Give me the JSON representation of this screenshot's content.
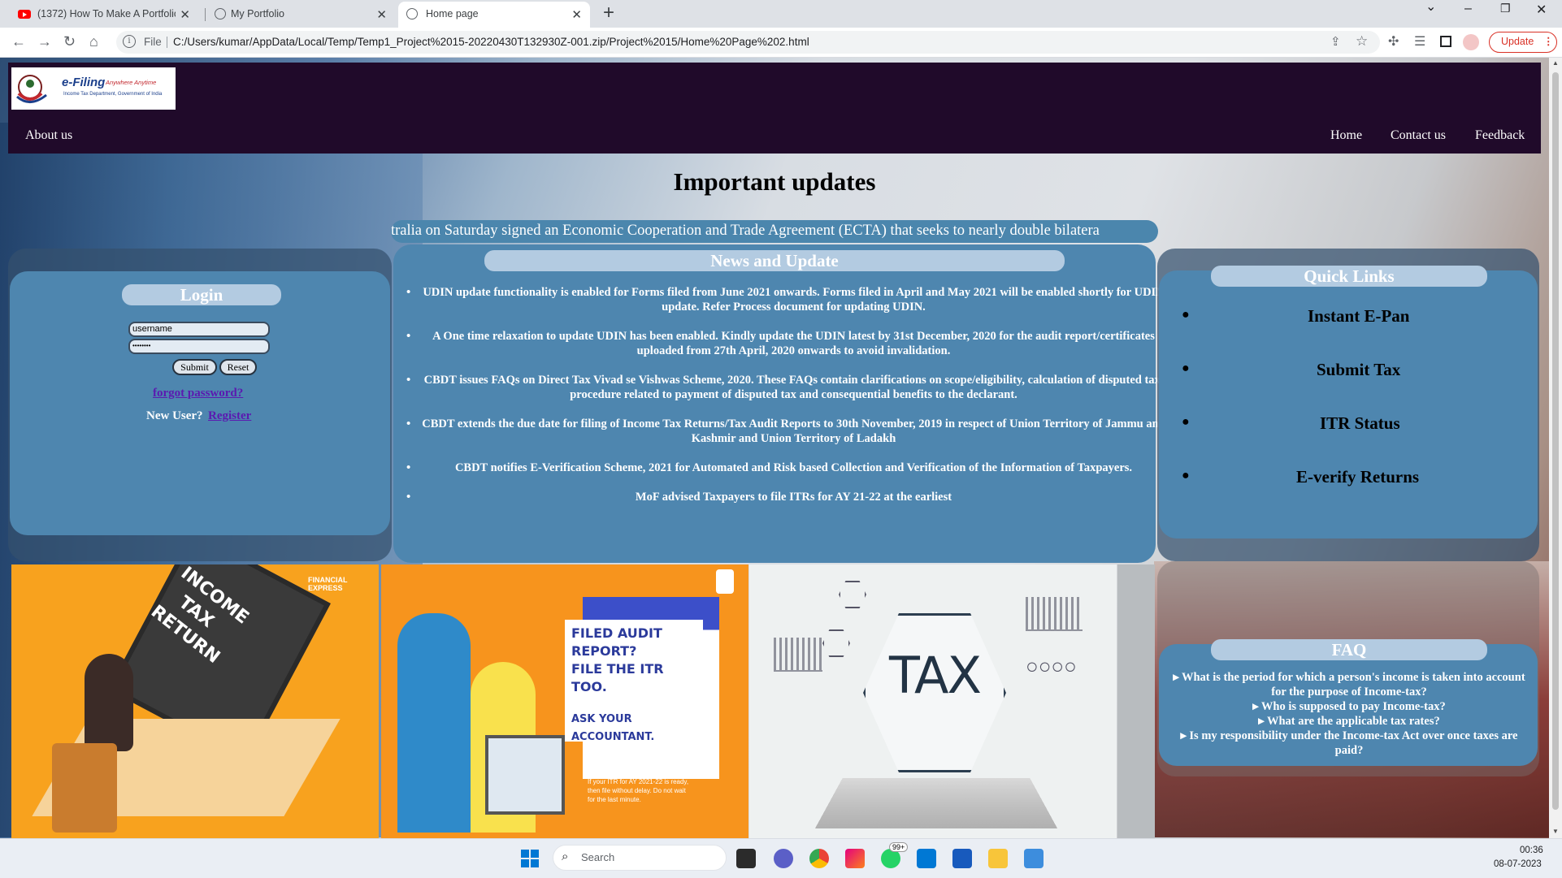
{
  "browser": {
    "tabs": [
      {
        "title": "(1372) How To Make A Portfolio",
        "icon": "youtube-icon"
      },
      {
        "title": "My Portfolio",
        "icon": "globe-icon"
      },
      {
        "title": "Home page",
        "icon": "globe-icon",
        "active": true
      }
    ],
    "new_tab": "+",
    "address_scheme": "File",
    "url": "C:/Users/kumar/AppData/Local/Temp/Temp1_Project%2015-20220430T132930Z-001.zip/Project%2015/Home%20Page%202.html",
    "update_label": "Update",
    "window_controls": {
      "minimize": "–",
      "restore": "❐",
      "close": "✕",
      "dropdown": "⌄"
    }
  },
  "site": {
    "logo": {
      "brand": "e-Filing",
      "tagline": "Anywhere Anytime",
      "sub": "Income Tax Department, Government of India"
    },
    "nav": {
      "about": "About us",
      "home": "Home",
      "contact": "Contact us",
      "feedback": "Feedback"
    },
    "title": "Important updates",
    "marquee": "tralia on Saturday signed an Economic Cooperation and Trade Agreement (ECTA) that seeks to nearly double bilatera",
    "login": {
      "heading": "Login",
      "username_value": "username",
      "password_value": "••••••••",
      "submit": "Submit",
      "reset": "Reset",
      "forgot": "forgot password?",
      "new_user": "New User?",
      "register": "Register"
    },
    "news": {
      "heading": "News and Update",
      "items": [
        "UDIN update functionality is enabled for Forms filed from June 2021 onwards. Forms filed in April and May 2021 will be enabled shortly for UDIN update. Refer Process document for updating UDIN.",
        "A One time relaxation to update UDIN has been enabled. Kindly update the UDIN latest by 31st December, 2020 for the audit report/certificates uploaded from 27th April, 2020 onwards to avoid invalidation.",
        "CBDT issues FAQs on Direct Tax Vivad se Vishwas Scheme, 2020. These FAQs contain clarifications on scope/eligibility, calculation of disputed tax, procedure related to payment of disputed tax and consequential benefits to the declarant.",
        "CBDT extends the due date for filing of Income Tax Returns/Tax Audit Reports to 30th November, 2019 in respect of Union Territory of Jammu and Kashmir and Union Territory of Ladakh",
        "CBDT notifies E-Verification Scheme, 2021 for Automated and Risk based Collection and Verification of the Information of Taxpayers.",
        "MoF advised Taxpayers to file ITRs for AY 21-22 at the earliest"
      ]
    },
    "quick_links": {
      "heading": "Quick Links",
      "items": [
        "Instant E-Pan",
        "Submit Tax",
        "ITR Status",
        "E-verify Returns"
      ]
    },
    "faq": {
      "heading": "FAQ",
      "items": [
        "What is the period for which a person's income is taken into account for the purpose of Income-tax?",
        "Who is supposed to pay Income-tax?",
        "What are the applicable tax rates?",
        "Is my responsibility under the Income-tax Act over once taxes are paid?"
      ]
    },
    "images": {
      "image1_text": [
        "INCOME",
        "TAX",
        "RETURN"
      ],
      "image1_credit": "FINANCIAL EXPRESS",
      "image2_lines": [
        "FILED AUDIT REPORT?",
        "FILE THE ITR TOO.",
        "ASK YOUR ACCOUNTANT."
      ],
      "image2_small": [
        "If your ITR for AY 2021-22 is ready,",
        "then file without delay. Do not wait",
        "for the last minute."
      ],
      "image3_text": "TAX"
    }
  },
  "taskbar": {
    "search_placeholder": "Search",
    "time": "00:36",
    "date": "08-07-2023",
    "badge": "99+"
  }
}
